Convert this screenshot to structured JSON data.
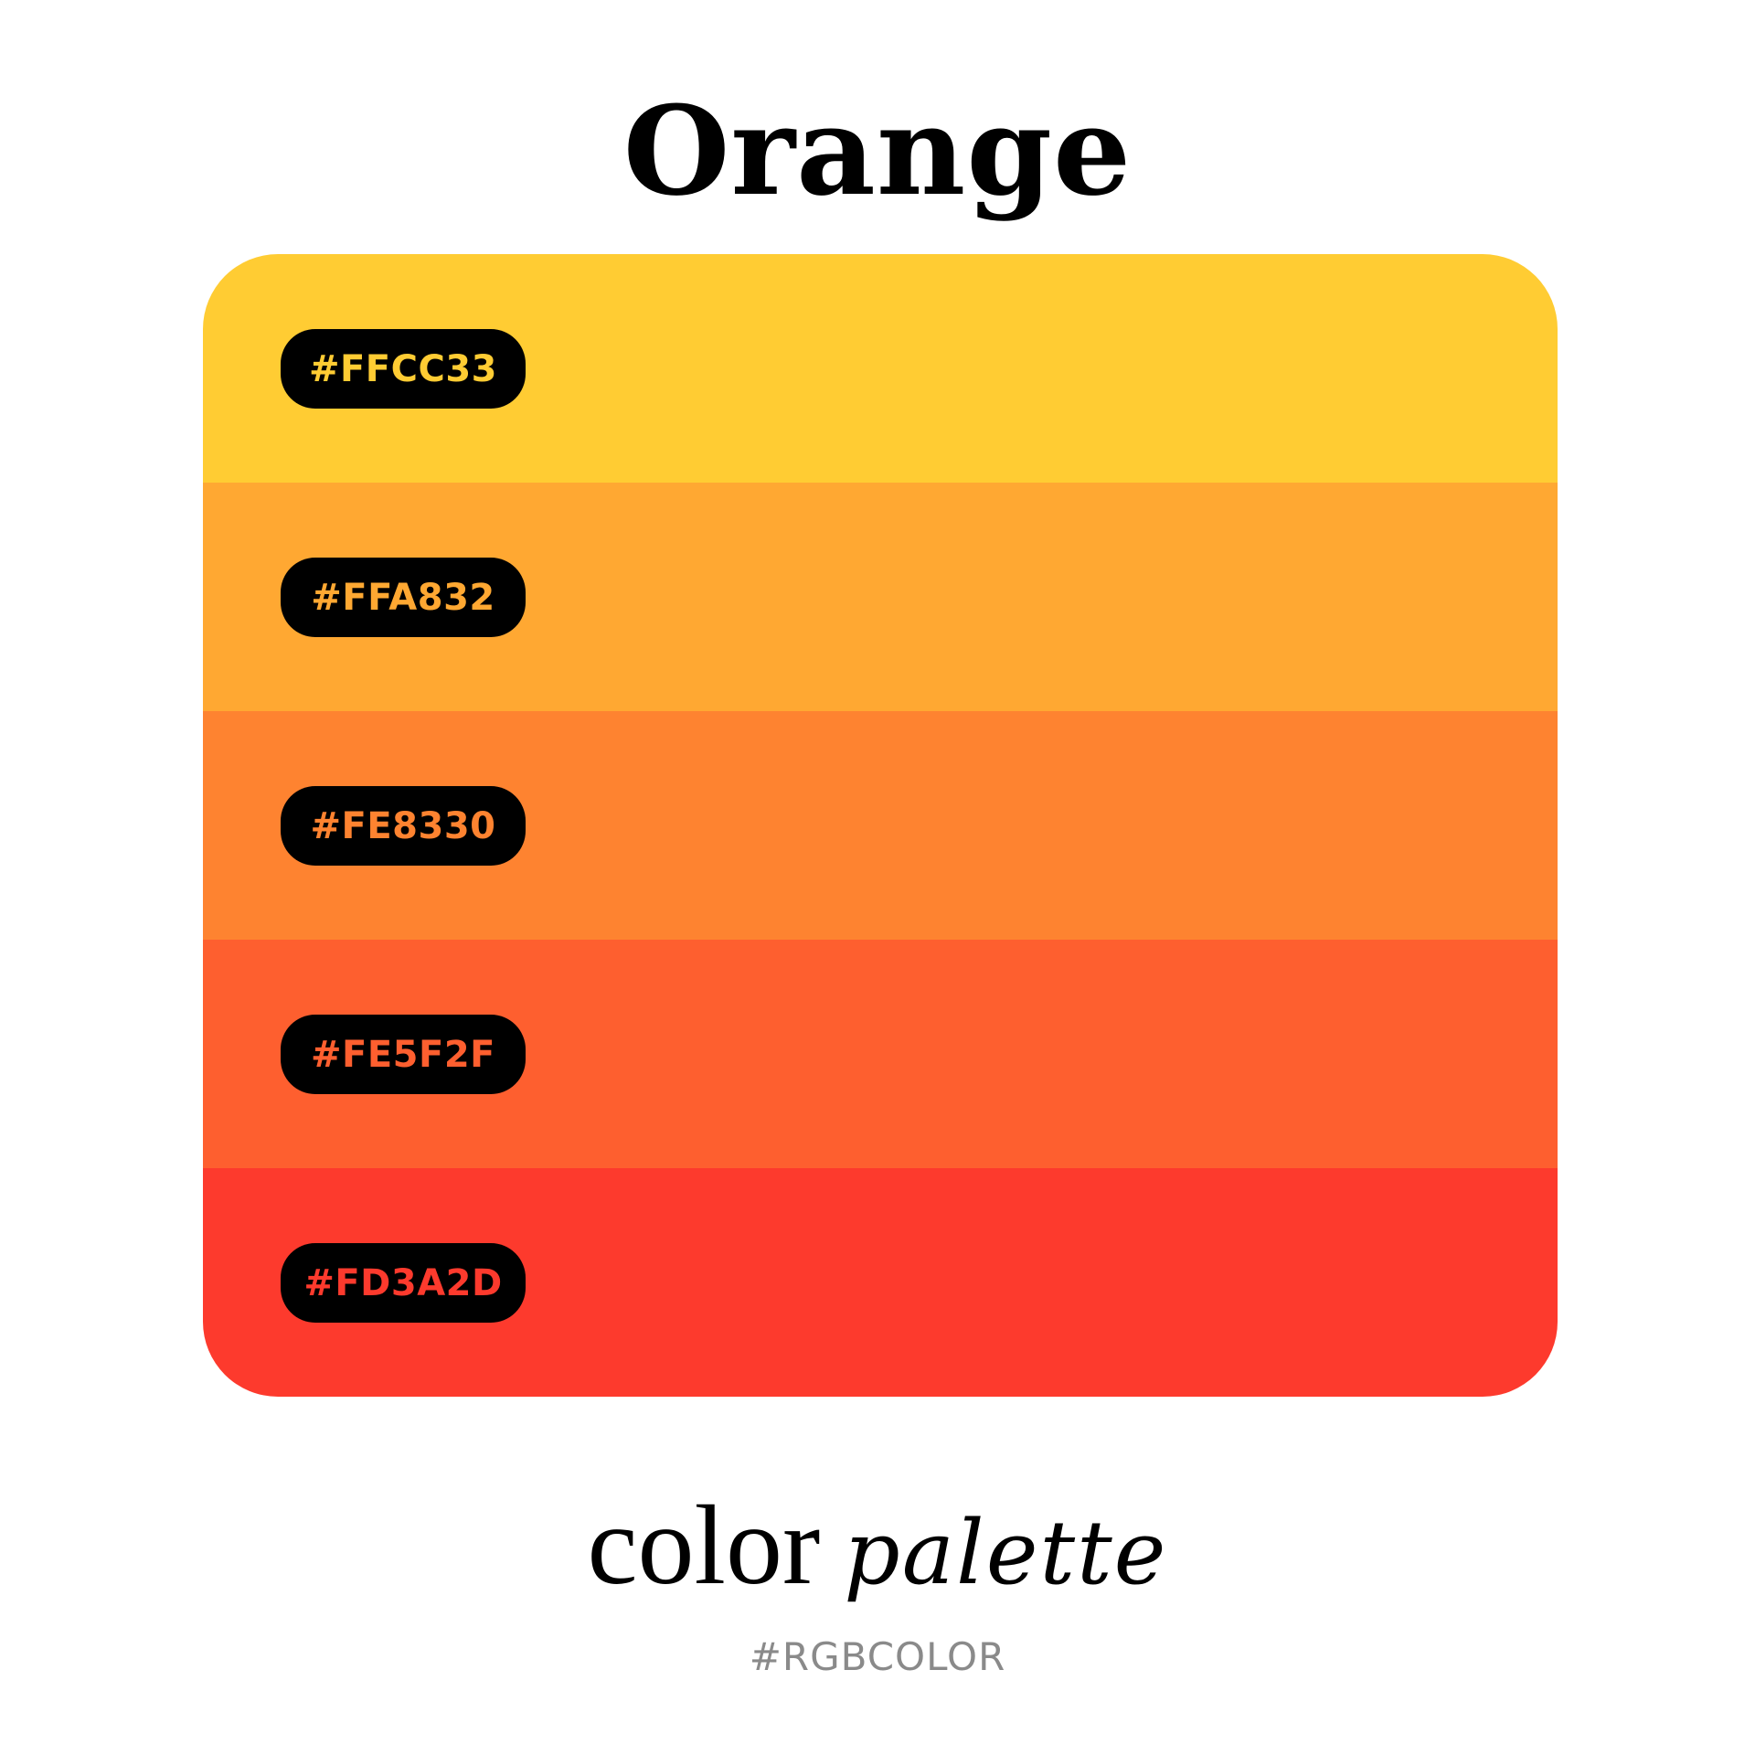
{
  "title": "Orange",
  "swatches": [
    {
      "hex": "#FFCC33",
      "color": "#FFCC33"
    },
    {
      "hex": "#FFA832",
      "color": "#FFA832"
    },
    {
      "hex": "#FE8330",
      "color": "#FE8330"
    },
    {
      "hex": "#FE5F2F",
      "color": "#FE5F2F"
    },
    {
      "hex": "#FD3A2D",
      "color": "#FD3A2D"
    }
  ],
  "footer": {
    "word1": "color",
    "word2": "palette"
  },
  "hashtag": "#RGBCOLOR"
}
